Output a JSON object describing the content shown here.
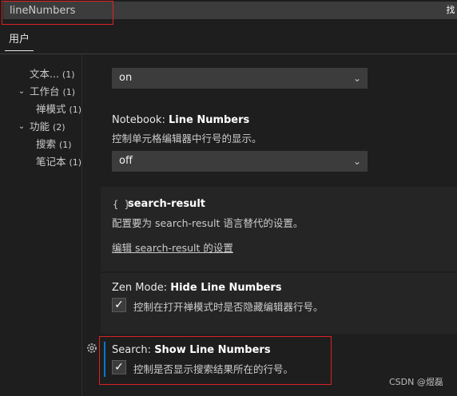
{
  "search": {
    "value": "lineNumbers",
    "right_button": "找"
  },
  "tabs": {
    "user": "用户"
  },
  "toc": {
    "items": [
      {
        "label": "文本...",
        "count": "(1)"
      },
      {
        "label": "工作台",
        "count": "(1)"
      },
      {
        "label": "禅模式",
        "count": "(1)"
      },
      {
        "label": "功能",
        "count": "(2)"
      },
      {
        "label": "搜索",
        "count": "(1)"
      },
      {
        "label": "笔记本",
        "count": "(1)"
      }
    ]
  },
  "settings": {
    "first_select": {
      "value": "on"
    },
    "notebook": {
      "category": "Notebook: ",
      "name": "Line Numbers",
      "description": "控制单元格编辑器中行号的显示。",
      "select_value": "off"
    },
    "search_result": {
      "icon_text": "{ }",
      "name": "search-result",
      "description": "配置要为 search-result 语言替代的设置。",
      "link": "编辑 search-result 的设置"
    },
    "zen": {
      "category": "Zen Mode: ",
      "name": "Hide Line Numbers",
      "description": "控制在打开禅模式时是否隐藏编辑器行号。",
      "checked": true
    },
    "search_show": {
      "category": "Search: ",
      "name": "Show Line Numbers",
      "description": "控制是否显示搜索结果所在的行号。",
      "checked": true
    }
  },
  "watermark": "CSDN @煜磊",
  "colors": {
    "background": "#1e1e1e",
    "panel": "#252526",
    "input": "#3c3c3c",
    "focus": "#007acc",
    "highlight": "#dd2222"
  }
}
